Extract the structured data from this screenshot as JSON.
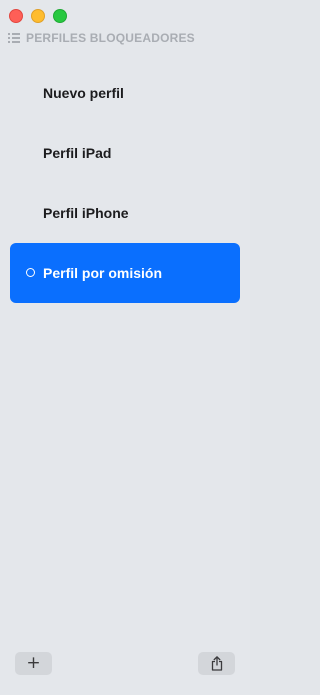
{
  "window": {
    "traffic_lights": [
      "close",
      "minimize",
      "zoom"
    ]
  },
  "sidebar": {
    "header": "PERFILES BLOQUEADORES",
    "header_icon": "list-icon",
    "items": [
      {
        "label": "Nuevo perfil",
        "selected": false
      },
      {
        "label": "Perfil iPad",
        "selected": false
      },
      {
        "label": "Perfil iPhone",
        "selected": false
      },
      {
        "label": "Perfil por omisión",
        "selected": true
      }
    ]
  },
  "toolbar": {
    "add_icon": "plus-icon",
    "share_icon": "share-icon"
  },
  "colors": {
    "accent": "#0a6ffe",
    "background": "#e4e7eb"
  }
}
